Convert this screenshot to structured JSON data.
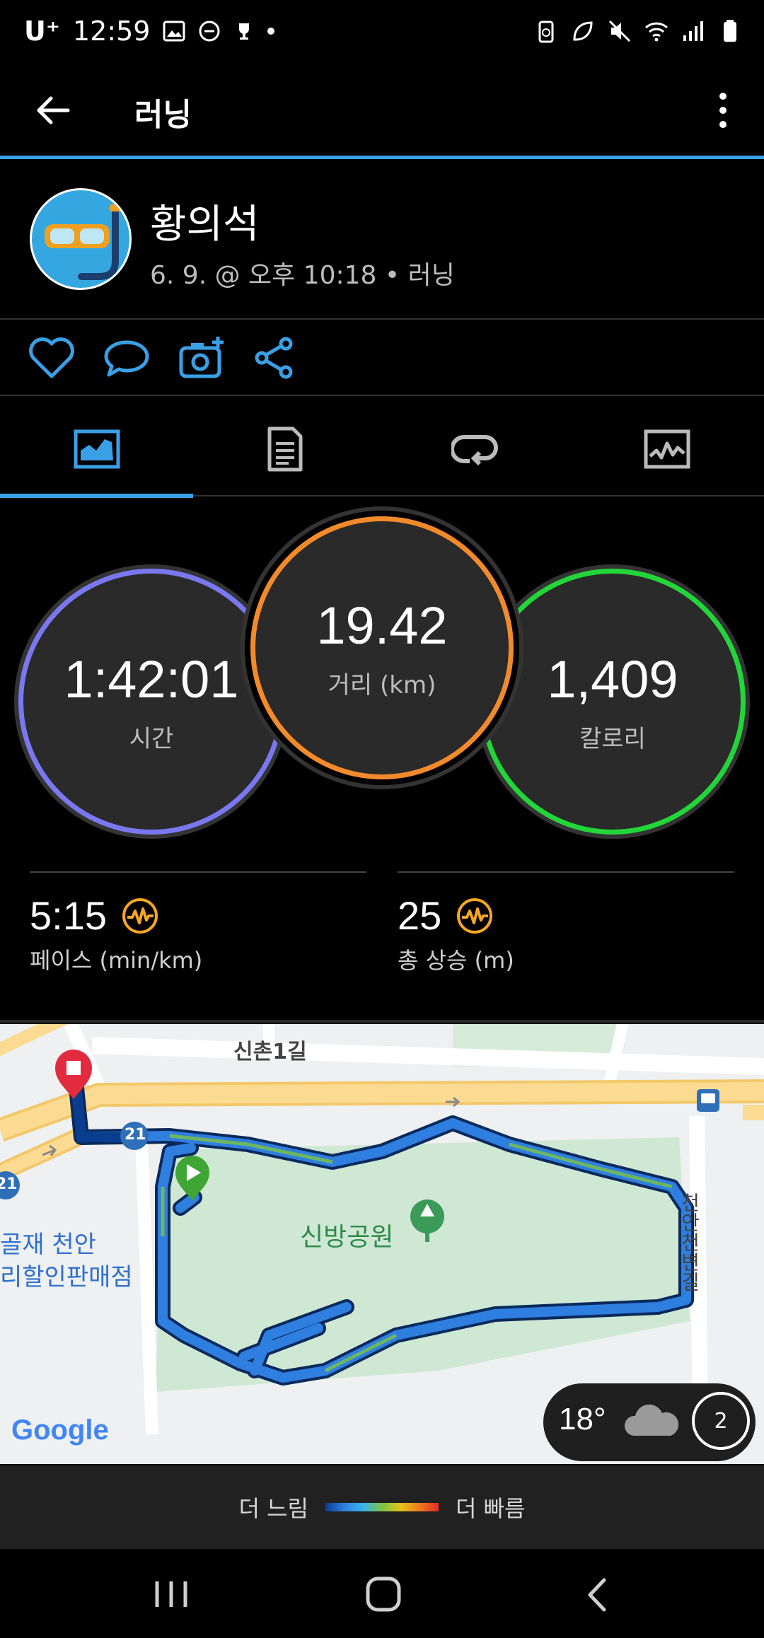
{
  "status_bar": {
    "carrier": "U⁺",
    "time": "12:59"
  },
  "app_bar": {
    "title": "러닝"
  },
  "profile": {
    "name": "황의석",
    "subtitle": "6. 9. @ 오후 10:18 • 러닝"
  },
  "stats_circles": {
    "time": {
      "value": "1:42:01",
      "label": "시간"
    },
    "distance": {
      "value": "19.42",
      "label": "거리 (km)"
    },
    "calories": {
      "value": "1,409",
      "label": "칼로리"
    }
  },
  "stats": {
    "pace": {
      "value": "5:15",
      "label": "페이스 (min/km)"
    },
    "ascent": {
      "value": "25",
      "label": "총 상승 (m)"
    }
  },
  "map": {
    "street_label": "신촌1길",
    "park_label": "신방공원",
    "store_label_line1": "골재 천안",
    "store_label_line2": "리할인판매점",
    "side_street": "천안천변길",
    "route_number": "21",
    "route_number_2": "21",
    "google_logo": "Google"
  },
  "weather": {
    "temp": "18°",
    "wind": "2"
  },
  "legend": {
    "slow": "더 느림",
    "fast": "더 빠름",
    "colors": [
      "#0a3d8f",
      "#2f7fe0",
      "#35b5e8",
      "#7cc444",
      "#e8c21a",
      "#f07a1c",
      "#e02a2a"
    ]
  },
  "colors": {
    "accent": "#3aa0e6",
    "time_ring": "#6a7cff",
    "distance_ring": "#f28a2c",
    "calorie_ring": "#22d63a",
    "badge": "#f5a623"
  }
}
